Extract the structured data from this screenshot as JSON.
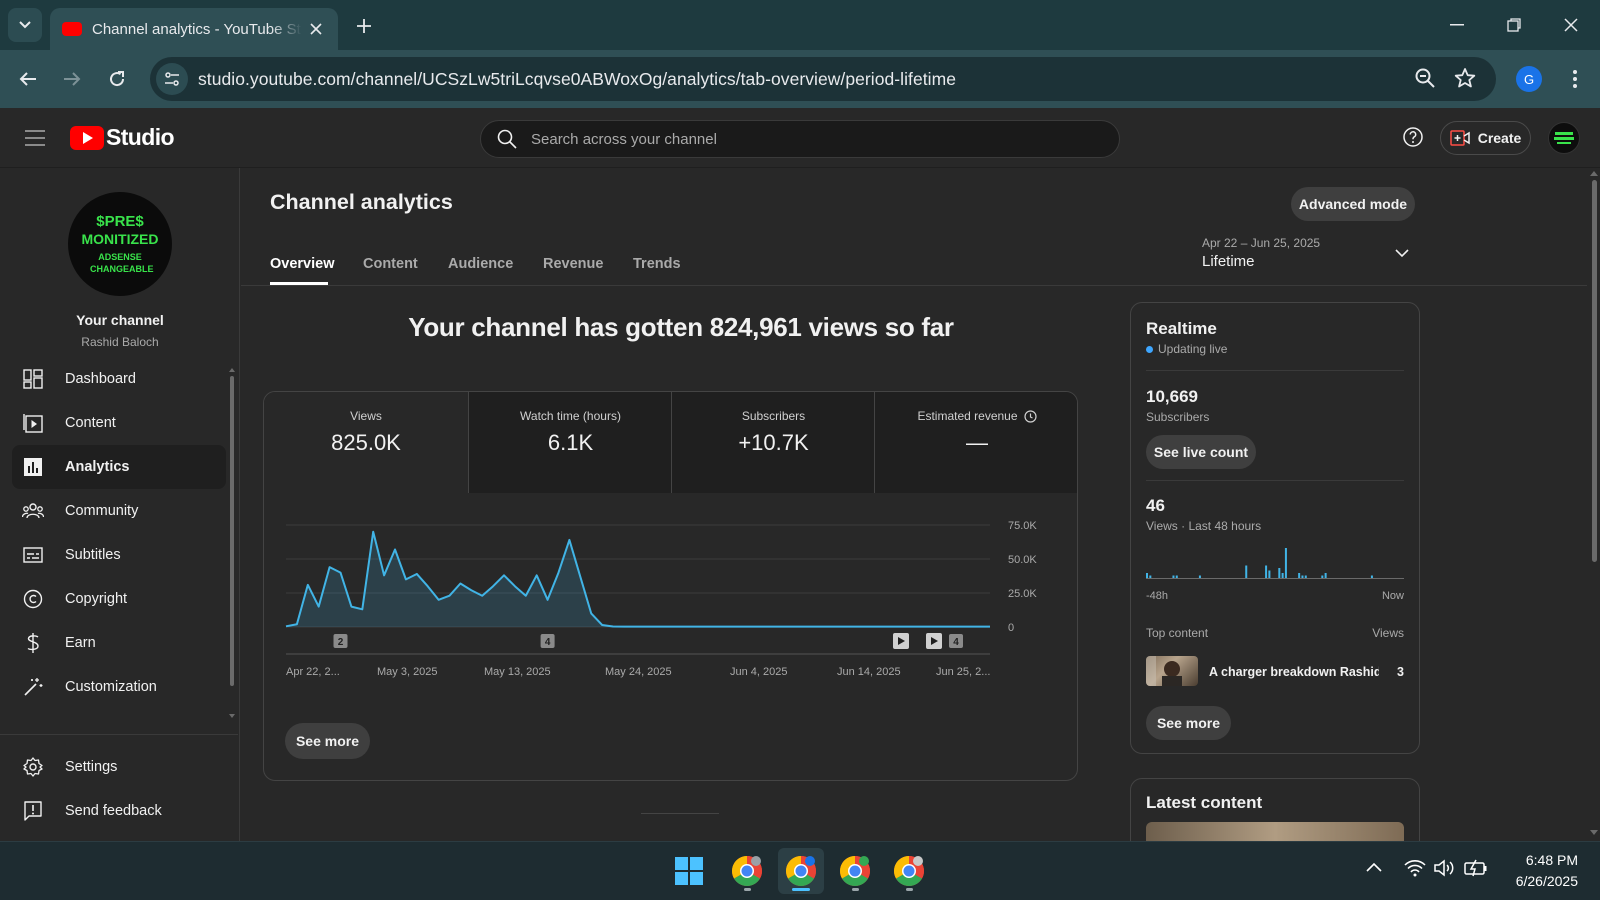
{
  "browser": {
    "tab_title": "Channel analytics - YouTube Studio",
    "url": "studio.youtube.com/channel/UCSzLw5triLcqvse0ABWoxOg/analytics/tab-overview/period-lifetime",
    "profile_initial": "G"
  },
  "header": {
    "logo_text": "Studio",
    "search_placeholder": "Search across your channel",
    "create_label": "Create"
  },
  "sidebar": {
    "avatar_lines": [
      "$PRE$",
      "MONITIZED",
      "ADSENSE CHANGEABLE"
    ],
    "channel_label": "Your channel",
    "channel_owner": "Rashid Baloch",
    "items": [
      {
        "label": "Dashboard",
        "icon": "dashboard-icon"
      },
      {
        "label": "Content",
        "icon": "content-icon"
      },
      {
        "label": "Analytics",
        "icon": "analytics-icon",
        "active": true
      },
      {
        "label": "Community",
        "icon": "community-icon"
      },
      {
        "label": "Subtitles",
        "icon": "subtitles-icon"
      },
      {
        "label": "Copyright",
        "icon": "copyright-icon"
      },
      {
        "label": "Earn",
        "icon": "earn-icon"
      },
      {
        "label": "Customization",
        "icon": "customization-icon"
      }
    ],
    "bottom_items": [
      {
        "label": "Settings",
        "icon": "settings-icon"
      },
      {
        "label": "Send feedback",
        "icon": "feedback-icon"
      }
    ]
  },
  "main": {
    "title": "Channel analytics",
    "advanced_mode": "Advanced mode",
    "tabs": [
      "Overview",
      "Content",
      "Audience",
      "Revenue",
      "Trends"
    ],
    "active_tab": "Overview",
    "period_range": "Apr 22 – Jun 25, 2025",
    "period_name": "Lifetime",
    "headline": "Your channel has gotten 824,961 views so far",
    "metrics": [
      {
        "label": "Views",
        "value": "825.0K"
      },
      {
        "label": "Watch time (hours)",
        "value": "6.1K"
      },
      {
        "label": "Subscribers",
        "value": "+10.7K"
      },
      {
        "label": "Estimated revenue",
        "value": "—"
      }
    ],
    "see_more": "See more"
  },
  "chart_data": {
    "type": "area",
    "series": [
      {
        "name": "Views",
        "color": "#41b4e6"
      }
    ],
    "x_tick_labels": [
      "Apr 22, 2...",
      "May 3, 2025",
      "May 13, 2025",
      "May 24, 2025",
      "Jun 4, 2025",
      "Jun 14, 2025",
      "Jun 25, 2..."
    ],
    "y_tick_labels": [
      "75.0K",
      "50.0K",
      "25.0K",
      "0"
    ],
    "ylim": [
      0,
      75000
    ],
    "x": [
      "Apr 22",
      "Apr 23",
      "Apr 24",
      "Apr 25",
      "Apr 26",
      "Apr 27",
      "Apr 28",
      "Apr 29",
      "Apr 30",
      "May 1",
      "May 2",
      "May 3",
      "May 4",
      "May 5",
      "May 6",
      "May 7",
      "May 8",
      "May 9",
      "May 10",
      "May 11",
      "May 12",
      "May 13",
      "May 14",
      "May 15",
      "May 16",
      "May 17",
      "May 18",
      "May 19",
      "May 20",
      "May 21",
      "May 22",
      "May 23",
      "May 24",
      "Jun 25"
    ],
    "values": [
      500,
      2000,
      31000,
      15000,
      44000,
      40000,
      15000,
      13000,
      70000,
      38000,
      57000,
      35000,
      39000,
      30000,
      20000,
      23000,
      32000,
      27000,
      23000,
      30000,
      38000,
      30000,
      23000,
      38000,
      20000,
      40000,
      64000,
      37000,
      10000,
      1500,
      400,
      300,
      300,
      300
    ],
    "markers": [
      {
        "label": "2",
        "type": "badge",
        "date": "Apr 27"
      },
      {
        "label": "4",
        "type": "badge",
        "date": "May 16"
      },
      {
        "label": "",
        "type": "video",
        "date": "Jun 21"
      },
      {
        "label": "",
        "type": "video",
        "date": "Jun 23"
      },
      {
        "label": "4",
        "type": "badge",
        "date": "Jun 24"
      }
    ]
  },
  "realtime": {
    "title": "Realtime",
    "live_label": "Updating live",
    "subscribers_value": "10,669",
    "subscribers_label": "Subscribers",
    "see_live": "See live count",
    "views_value": "46",
    "views_label": "Views · Last 48 hours",
    "bars_left": "-48h",
    "bars_right": "Now",
    "hourly_views": [
      2,
      1,
      0,
      0,
      0,
      0,
      0,
      0,
      1,
      1,
      0,
      0,
      0,
      0,
      0,
      0,
      1,
      0,
      0,
      0,
      0,
      0,
      0,
      0,
      0,
      0,
      0,
      0,
      0,
      0,
      5,
      0,
      0,
      0,
      0,
      0,
      5,
      3,
      0,
      0,
      4,
      2,
      12,
      0,
      0,
      0,
      2,
      1,
      1,
      0,
      0,
      0,
      0,
      1,
      2,
      0,
      0,
      0,
      0,
      0,
      0,
      0,
      0,
      0,
      0,
      0,
      0,
      0,
      1,
      0,
      0,
      0,
      0,
      0,
      0,
      0,
      0,
      0
    ],
    "top_content": "Top content",
    "top_views_label": "Views",
    "video_title": "A charger breakdown Rashid ...",
    "video_views": "3",
    "see_more": "See more"
  },
  "latest": {
    "title": "Latest content"
  },
  "taskbar": {
    "time": "6:48 PM",
    "date": "6/26/2025"
  }
}
